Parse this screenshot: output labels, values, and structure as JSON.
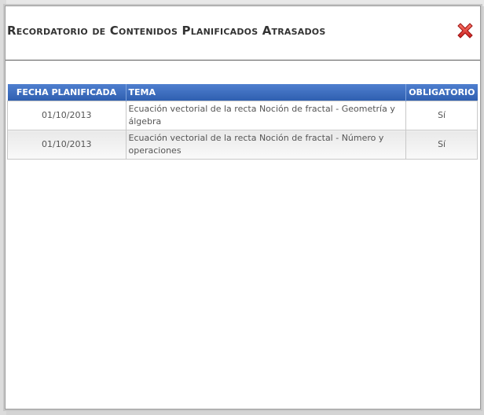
{
  "dialog": {
    "title": "Recordatorio de Contenidos Planificados Atrasados",
    "close_icon": "close-icon",
    "close_color": "#e03030"
  },
  "table": {
    "headers": {
      "fecha": "FECHA PLANIFICADA",
      "tema": "TEMA",
      "obligatorio": "OBLIGATORIO"
    },
    "header_color": "#3a6bc0",
    "rows": [
      {
        "fecha": "01/10/2013",
        "tema": "Ecuación vectorial de la recta Noción de fractal - Geometría y álgebra",
        "obligatorio": "Sí"
      },
      {
        "fecha": "01/10/2013",
        "tema": "Ecuación vectorial de la recta Noción de fractal - Número y operaciones",
        "obligatorio": "Sí"
      }
    ]
  }
}
